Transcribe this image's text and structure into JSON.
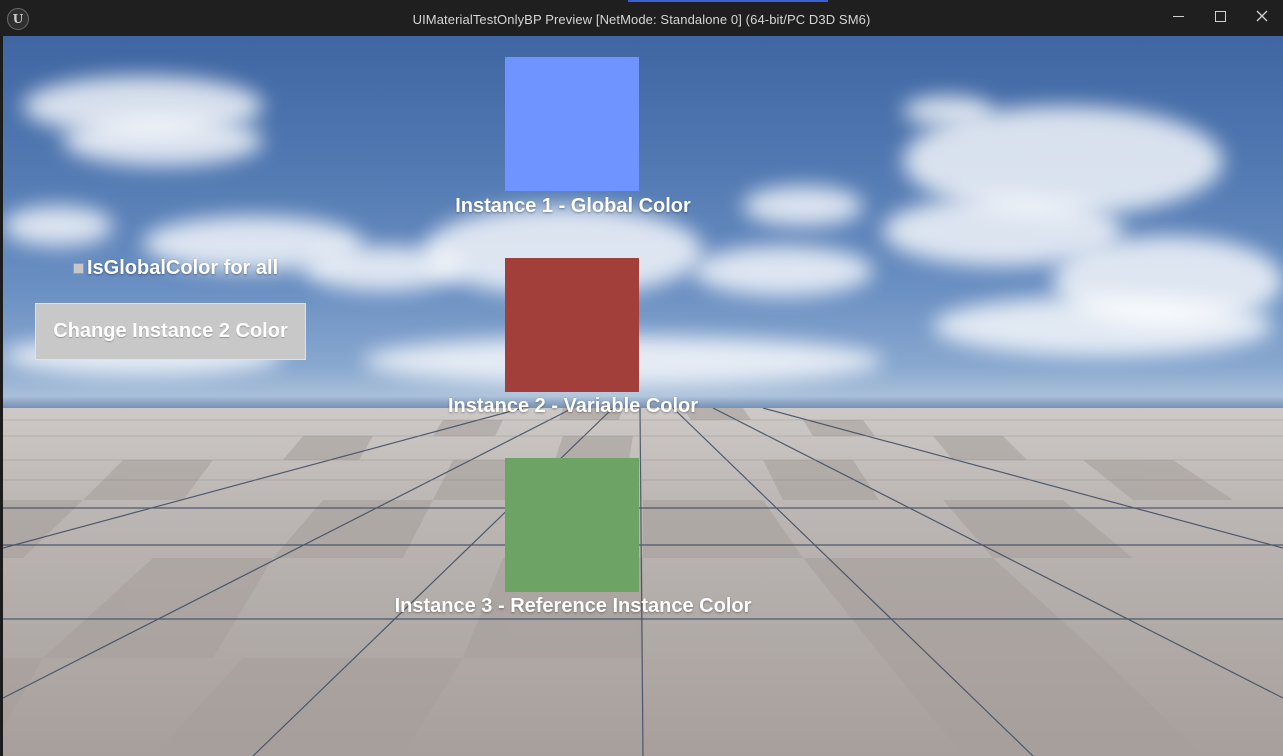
{
  "window": {
    "title": "UIMaterialTestOnlyBP Preview [NetMode: Standalone 0]  (64-bit/PC D3D SM6)",
    "logo_glyph": "U",
    "controls": {
      "minimize_icon": "minimize-icon",
      "maximize_icon": "maximize-icon",
      "close_icon": "close-icon"
    }
  },
  "controls": {
    "global_color_checkbox": {
      "label": "IsGlobalColor for all",
      "checked": false
    },
    "change_button_label": "Change Instance 2 Color"
  },
  "instances": [
    {
      "label": "Instance 1 - Global Color",
      "color": "#7094ff"
    },
    {
      "label": "Instance 2 - Variable Color",
      "color": "#a23f3b"
    },
    {
      "label": "Instance 3 - Reference Instance Color",
      "color": "#6ea366"
    }
  ]
}
